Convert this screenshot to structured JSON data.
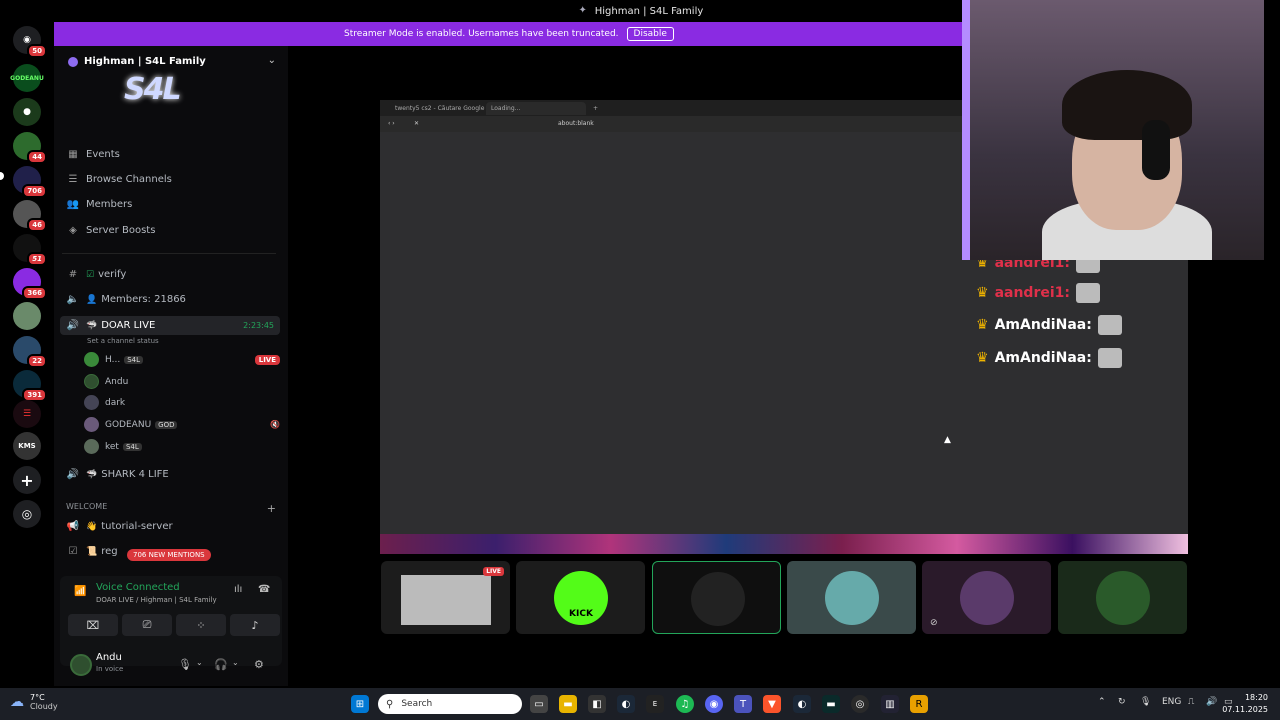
{
  "window": {
    "title": "Highman | S4L Family"
  },
  "banner": {
    "text": "Streamer Mode is enabled. Usernames have been truncated.",
    "disable_label": "Disable"
  },
  "rail": {
    "badges": [
      "50",
      "44",
      "706",
      "46",
      "51",
      "366",
      "22",
      "391"
    ],
    "labels": {
      "godeanu": "GODEANU",
      "kms": "KMS"
    }
  },
  "server": {
    "name": "Highman | S4L Family",
    "banner_text": "S4L"
  },
  "nav": [
    {
      "label": "Events",
      "icon": "calendar-icon"
    },
    {
      "label": "Browse Channels",
      "icon": "list-icon"
    },
    {
      "label": "Members",
      "icon": "members-icon"
    },
    {
      "label": "Server Boosts",
      "icon": "boost-icon"
    }
  ],
  "channels": {
    "verify": "verify",
    "members": "Members: 21866",
    "live": {
      "name": "DOAR LIVE",
      "time": "2:23:45",
      "status": "Set a channel status"
    },
    "shark": "SHARK 4 LIFE",
    "category": "WELCOME",
    "tutorial": "tutorial-server",
    "reg": "reg",
    "mentions": "706 NEW MENTIONS"
  },
  "voice_users": [
    {
      "name": "H...",
      "tag": "S4L",
      "live": "LIVE"
    },
    {
      "name": "Andu"
    },
    {
      "name": "dark"
    },
    {
      "name": "GODEANU",
      "tag": "GOD"
    },
    {
      "name": "ket",
      "tag": "S4L"
    }
  ],
  "voice_panel": {
    "title": "Voice Connected",
    "sub": "DOAR LIVE / Highman | S4L Family"
  },
  "user": {
    "name": "Andu",
    "status": "In voice"
  },
  "browser": {
    "tab1": "twenty5 cs2 - Căutare Google",
    "tab2": "Loading...",
    "url": "about:blank"
  },
  "chat": [
    {
      "user": "aandrei1:",
      "color": "#e0304a"
    },
    {
      "user": "aandrei1:",
      "color": "#e0304a"
    },
    {
      "user": "AmAndiNaa:",
      "color": "#ffffff"
    },
    {
      "user": "AmAndiNaa:",
      "color": "#ffffff"
    }
  ],
  "tiles": {
    "live": "LIVE",
    "kick": "KICK"
  },
  "taskbar": {
    "temp": "7°C",
    "weather": "Cloudy",
    "search_placeholder": "Search",
    "lang": "ENG",
    "time": "18:20",
    "date": "07.11.2025"
  },
  "colors": {
    "accent": "#8a2be2",
    "live_red": "#da373c",
    "green": "#23a55a"
  }
}
